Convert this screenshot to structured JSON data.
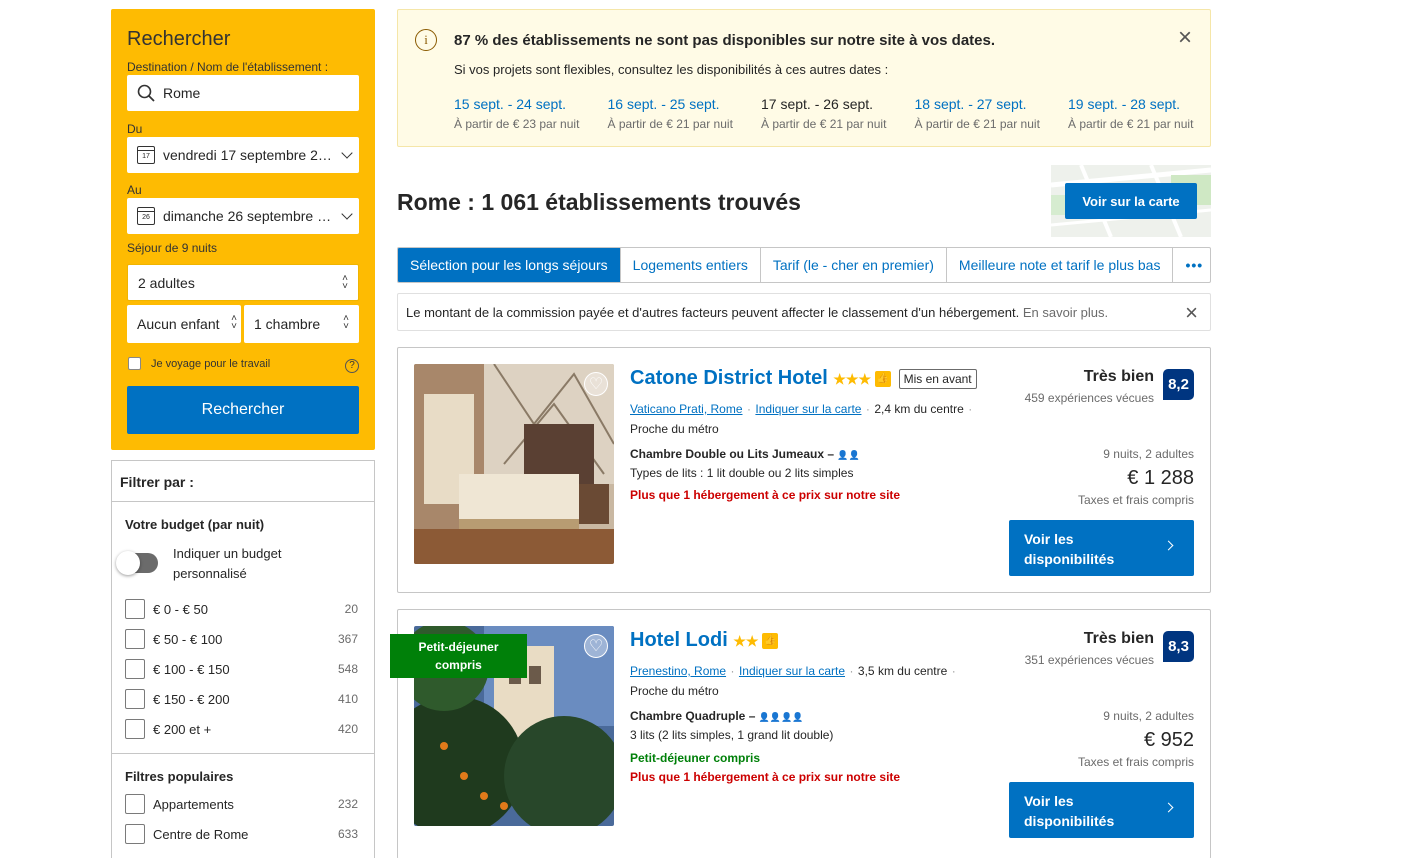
{
  "search": {
    "title": "Rechercher",
    "destination_label": "Destination / Nom de l'établissement :",
    "destination_value": "Rome",
    "checkin_label": "Du",
    "checkin_value": "vendredi 17 septembre 20...",
    "checkin_day": "17",
    "checkout_label": "Au",
    "checkout_value": "dimanche 26 septembre 2...",
    "checkout_day": "26",
    "stay_text": "Séjour de 9 nuits",
    "adults": "2 adultes",
    "children": "Aucun enfant",
    "rooms": "1 chambre",
    "business_label": "Je voyage pour le travail",
    "help_icon": "?",
    "button": "Rechercher"
  },
  "filters": {
    "title": "Filtrer par :",
    "budget_title": "Votre budget (par nuit)",
    "custom_budget_line1": "Indiquer un budget",
    "custom_budget_line2": "personnalisé",
    "budget_options": [
      {
        "label": "€ 0 - € 50",
        "count": "20"
      },
      {
        "label": "€ 50 - € 100",
        "count": "367"
      },
      {
        "label": "€ 100 - € 150",
        "count": "548"
      },
      {
        "label": "€ 150 - € 200",
        "count": "410"
      },
      {
        "label": "€ 200 et +",
        "count": "420"
      }
    ],
    "popular_title": "Filtres populaires",
    "popular_options": [
      {
        "label": "Appartements",
        "count": "232"
      },
      {
        "label": "Centre de Rome",
        "count": "633"
      }
    ]
  },
  "notice": {
    "title": "87 % des établissements ne sont pas disponibles sur notre site à vos dates.",
    "subtitle": "Si vos projets sont flexibles, consultez les disponibilités à ces autres dates :",
    "info_icon": "i",
    "close_icon": "×",
    "dates": [
      {
        "range": "15 sept. - 24 sept.",
        "price": "À partir de € 23 par nuit"
      },
      {
        "range": "16 sept. - 25 sept.",
        "price": "À partir de € 21 par nuit"
      },
      {
        "range": "17 sept. - 26 sept.",
        "price": "À partir de € 21 par nuit"
      },
      {
        "range": "18 sept. - 27 sept.",
        "price": "À partir de € 21 par nuit"
      },
      {
        "range": "19 sept. - 28 sept.",
        "price": "À partir de € 21 par nuit"
      }
    ]
  },
  "results": {
    "heading": "Rome : 1 061 établissements trouvés",
    "map_button": "Voir sur la carte"
  },
  "tabs": [
    "Sélection pour les longs séjours",
    "Logements entiers",
    "Tarif (le - cher en premier)",
    "Meilleure note et tarif le plus bas",
    "•••"
  ],
  "commission": {
    "text": "Le montant de la commission payée et d'autres facteurs peuvent affecter le classement d'un hébergement.",
    "link": "En savoir plus.",
    "close": "×"
  },
  "hotels": [
    {
      "name": "Catone District Hotel",
      "stars": "★★★",
      "badge": "Mis en avant",
      "area": "Vaticano Prati, Rome",
      "map_link": "Indiquer sur la carte",
      "distance": "2,4 km du centre",
      "metro": "Proche du métro",
      "room": "Chambre Double ou Lits Jumeaux –",
      "room_icons": "👤👤",
      "beds": "Types de lits : 1 lit double ou 2 lits simples",
      "breakfast": "",
      "scarcity": "Plus que 1 hébergement à ce prix sur notre site",
      "rating_word": "Très bien",
      "reviews": "459 expériences vécues",
      "score": "8,2",
      "stay": "9 nuits, 2 adultes",
      "price": "€ 1 288",
      "taxes": "Taxes et frais compris",
      "cta_line1": "Voir les",
      "cta_line2": "disponibilités"
    },
    {
      "name": "Hotel Lodi",
      "stars": "★★",
      "ribbon_line1": "Petit-déjeuner",
      "ribbon_line2": "compris",
      "area": "Prenestino, Rome",
      "map_link": "Indiquer sur la carte",
      "distance": "3,5 km du centre",
      "metro": "Proche du métro",
      "room": "Chambre Quadruple –",
      "room_icons": "👤👤👤👤",
      "beds": "3 lits (2 lits simples, 1 grand lit double)",
      "breakfast": "Petit-déjeuner compris",
      "scarcity": "Plus que 1 hébergement à ce prix sur notre site",
      "rating_word": "Très bien",
      "reviews": "351 expériences vécues",
      "score": "8,3",
      "stay": "9 nuits, 2 adultes",
      "price": "€ 952",
      "taxes": "Taxes et frais compris",
      "cta_line1": "Voir les",
      "cta_line2": "disponibilités"
    }
  ],
  "colors": {
    "brand_yellow": "#febb02",
    "brand_blue": "#0071c2",
    "score_blue": "#003580",
    "scarcity_red": "#cc0000",
    "breakfast_green": "#008009"
  }
}
